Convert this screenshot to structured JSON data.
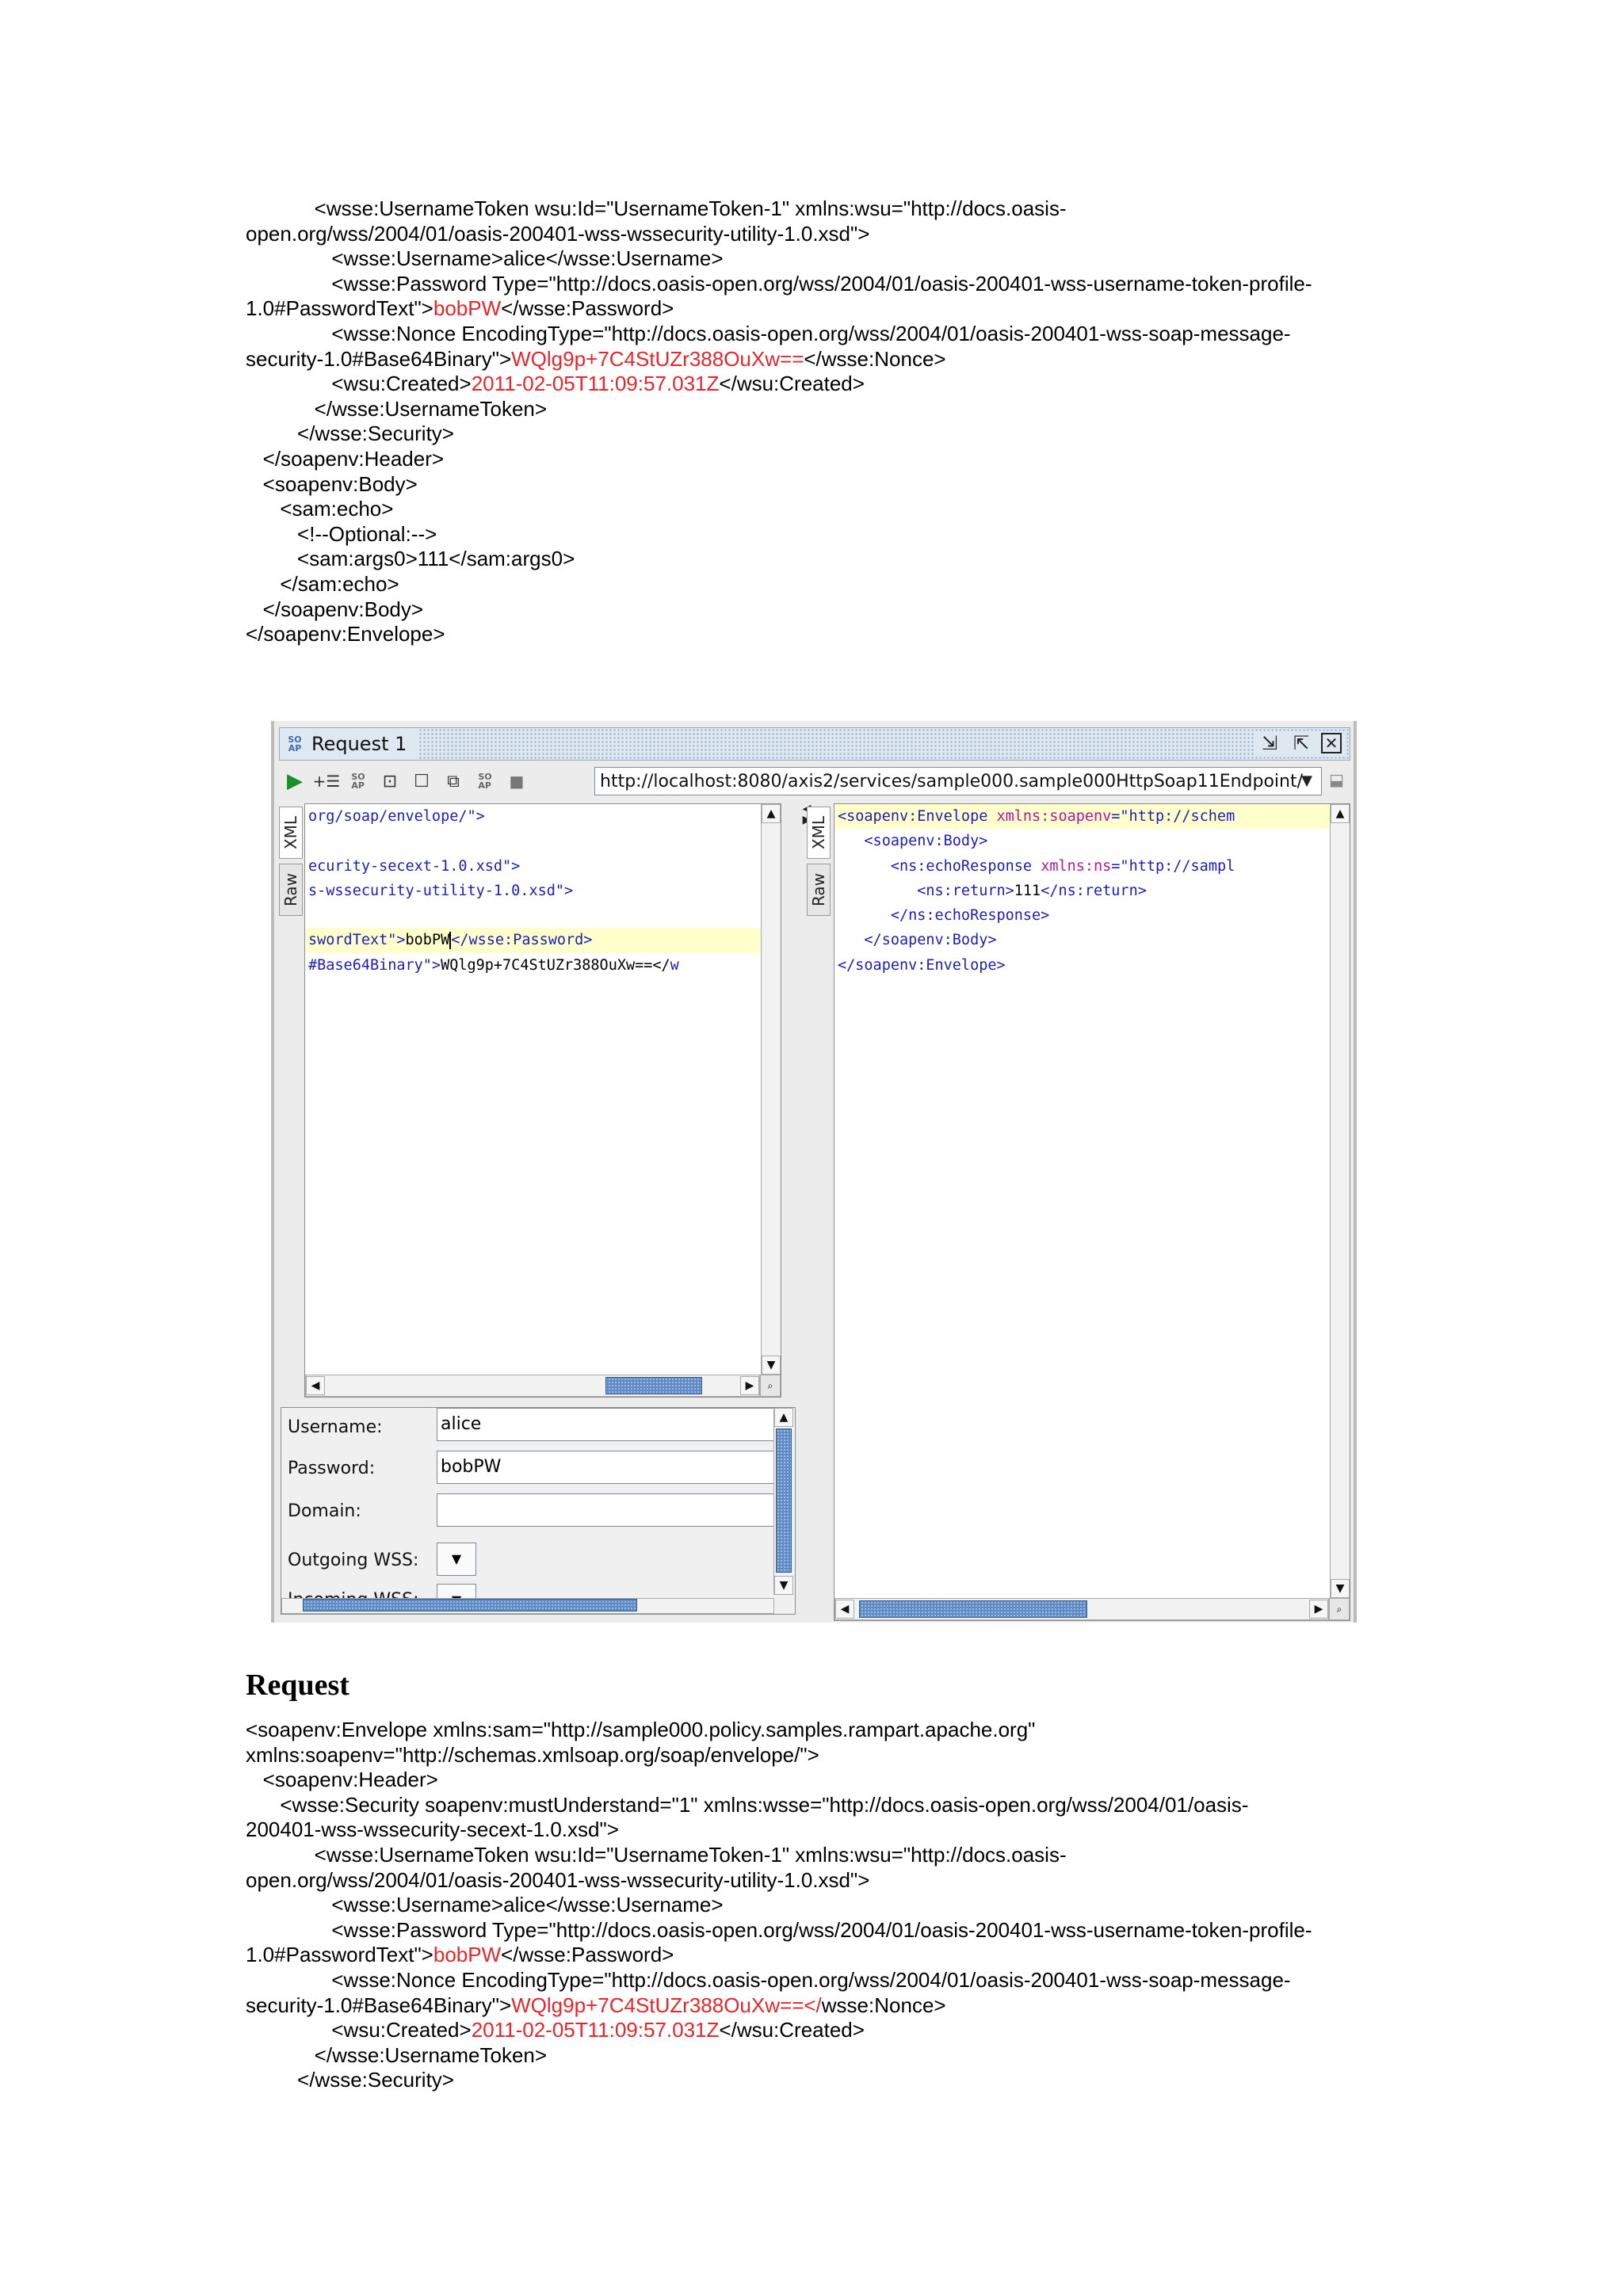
{
  "doc_top_lines": [
    [
      {
        "t": "            <wsse:UsernameToken wsu:Id=\"UsernameToken-1\" xmlns:wsu=\"http://docs.oasis-"
      }
    ],
    [
      {
        "t": "open.org/wss/2004/01/oasis-200401-wss-wssecurity-utility-1.0.xsd\">"
      }
    ],
    [
      {
        "t": "               <wsse:Username>alice</wsse:Username>"
      }
    ],
    [
      {
        "t": "               <wsse:Password Type=\"http://docs.oasis-open.org/wss/2004/01/oasis-200401-wss-username-token-profile-"
      }
    ],
    [
      {
        "t": "1.0#PasswordText\">"
      },
      {
        "t": "bobPW",
        "red": true
      },
      {
        "t": "</wsse:Password>"
      }
    ],
    [
      {
        "t": "               <wsse:Nonce EncodingType=\"http://docs.oasis-open.org/wss/2004/01/oasis-200401-wss-soap-message-"
      }
    ],
    [
      {
        "t": "security-1.0#Base64Binary\">"
      },
      {
        "t": "WQlg9p+7C4StUZr388OuXw==",
        "red": true
      },
      {
        "t": "</wsse:Nonce>"
      }
    ],
    [
      {
        "t": "               <wsu:Created>"
      },
      {
        "t": "2011-02-05T11:09:57.031Z",
        "red": true
      },
      {
        "t": "</wsu:Created>"
      }
    ],
    [
      {
        "t": "            </wsse:UsernameToken>"
      }
    ],
    [
      {
        "t": "         </wsse:Security>"
      }
    ],
    [
      {
        "t": "   </soapenv:Header>"
      }
    ],
    [
      {
        "t": "   <soapenv:Body>"
      }
    ],
    [
      {
        "t": "      <sam:echo>"
      }
    ],
    [
      {
        "t": "         <!--Optional:-->"
      }
    ],
    [
      {
        "t": "         <sam:args0>111</sam:args0>"
      }
    ],
    [
      {
        "t": "      </sam:echo>"
      }
    ],
    [
      {
        "t": "   </soapenv:Body>"
      }
    ],
    [
      {
        "t": "</soapenv:Envelope>"
      }
    ]
  ],
  "heading": "Request",
  "doc_bottom_lines": [
    [
      {
        "t": "<soapenv:Envelope xmlns:sam=\"http://sample000.policy.samples.rampart.apache.org\""
      }
    ],
    [
      {
        "t": "xmlns:soapenv=\"http://schemas.xmlsoap.org/soap/envelope/\">"
      }
    ],
    [
      {
        "t": "   <soapenv:Header>"
      }
    ],
    [
      {
        "t": "      <wsse:Security soapenv:mustUnderstand=\"1\" xmlns:wsse=\"http://docs.oasis-open.org/wss/2004/01/oasis-"
      }
    ],
    [
      {
        "t": "200401-wss-wssecurity-secext-1.0.xsd\">"
      }
    ],
    [
      {
        "t": "            <wsse:UsernameToken wsu:Id=\"UsernameToken-1\" xmlns:wsu=\"http://docs.oasis-"
      }
    ],
    [
      {
        "t": "open.org/wss/2004/01/oasis-200401-wss-wssecurity-utility-1.0.xsd\">"
      }
    ],
    [
      {
        "t": "               <wsse:Username>alice</wsse:Username>"
      }
    ],
    [
      {
        "t": "               <wsse:Password Type=\"http://docs.oasis-open.org/wss/2004/01/oasis-200401-wss-username-token-profile-"
      }
    ],
    [
      {
        "t": "1.0#PasswordText\">"
      },
      {
        "t": "bobPW",
        "red": true
      },
      {
        "t": "</wsse:Password>"
      }
    ],
    [
      {
        "t": "               <wsse:Nonce EncodingType=\"http://docs.oasis-open.org/wss/2004/01/oasis-200401-wss-soap-message-"
      }
    ],
    [
      {
        "t": "security-1.0#Base64Binary\">"
      },
      {
        "t": "WQlg9p+7C4StUZr388OuXw==</",
        "red": true
      },
      {
        "t": "wsse:Nonce>"
      }
    ],
    [
      {
        "t": "               <wsu:Created>"
      },
      {
        "t": "2011-02-05T11:09:57.031Z",
        "red": true
      },
      {
        "t": "</wsu:Created>"
      }
    ],
    [
      {
        "t": "            </wsse:UsernameToken>"
      }
    ],
    [
      {
        "t": "         </wsse:Security>"
      }
    ]
  ],
  "window": {
    "title": "Request 1",
    "soap_icon": "SO\nAP",
    "url": "http://localhost:8080/axis2/services/sample000.sample000HttpSoap11Endpoint/",
    "tabs_left": {
      "xml": "XML",
      "raw": "Raw"
    },
    "tabs_right": {
      "xml": "XML",
      "raw": "Raw"
    },
    "request_lines": [
      [
        {
          "t": "org/soap/envelope/\">",
          "c": "val"
        }
      ],
      [],
      [
        {
          "t": "ecurity-secext-1.0.xsd\">",
          "c": "val"
        }
      ],
      [
        {
          "t": "s-wssecurity-utility-1.0.xsd\">",
          "c": "val"
        }
      ],
      [],
      [
        {
          "t": "swordText\">",
          "c": "val"
        },
        {
          "t": "bobPW",
          "c": "txt"
        },
        {
          "t": "caret"
        },
        {
          "t": "</wsse:Password>",
          "c": "tag"
        }
      ],
      [
        {
          "t": "#Base64Binary\">",
          "c": "val"
        },
        {
          "t": "WQlg9p+7C4StUZr388OuXw==</",
          "c": "txt"
        },
        {
          "t": "w",
          "c": "tag"
        }
      ]
    ],
    "response_lines": [
      [
        {
          "t": "<soapenv:Envelope ",
          "c": "tag"
        },
        {
          "t": "xmlns:soapenv",
          "c": "attr"
        },
        {
          "t": "=\"http://schem",
          "c": "val"
        }
      ],
      [
        {
          "t": "   <soapenv:Body>",
          "c": "tag"
        }
      ],
      [
        {
          "t": "      <ns:echoResponse ",
          "c": "tag"
        },
        {
          "t": "xmlns:ns",
          "c": "attr"
        },
        {
          "t": "=\"http://sampl",
          "c": "val"
        }
      ],
      [
        {
          "t": "         <ns:return>",
          "c": "tag"
        },
        {
          "t": "111",
          "c": "txt"
        },
        {
          "t": "</ns:return>",
          "c": "tag"
        }
      ],
      [
        {
          "t": "      </ns:echoResponse>",
          "c": "tag"
        }
      ],
      [
        {
          "t": "   </soapenv:Body>",
          "c": "tag"
        }
      ],
      [
        {
          "t": "</soapenv:Envelope>",
          "c": "tag"
        }
      ]
    ],
    "props": {
      "username_label": "Username:",
      "username_value": "alice",
      "password_label": "Password:",
      "password_value": "bobPW",
      "domain_label": "Domain:",
      "domain_value": "",
      "outgoing_label": "Outgoing WSS:",
      "incoming_label": "Incoming WSS:"
    },
    "icons": {
      "play": "play-icon",
      "add_step": "add-step-icon",
      "wsdl": "wsdl-icon",
      "fit": "fit-icon",
      "single": "single-pane-icon",
      "tabs": "tabbed-pane-icon",
      "stop": "stop-icon"
    }
  }
}
